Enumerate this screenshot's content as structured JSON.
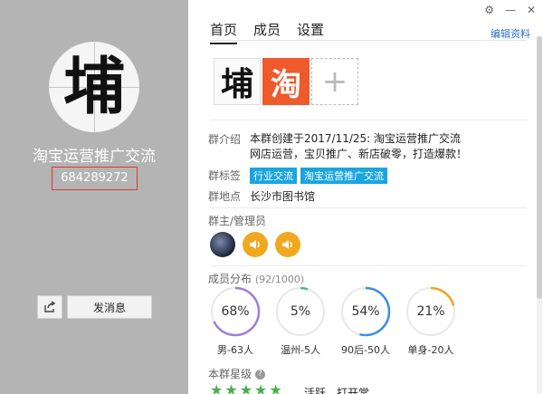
{
  "profile": {
    "avatar_char": "埔",
    "group_name": "淘宝运营推广交流",
    "group_id": "684289272",
    "message_button": "发消息"
  },
  "tabs": [
    {
      "label": "首页",
      "active": true
    },
    {
      "label": "成员",
      "active": false
    },
    {
      "label": "设置",
      "active": false
    }
  ],
  "edit_label": "编辑资料",
  "photos": {
    "photo1_char": "埔",
    "photo2_char": "淘",
    "add_symbol": "+"
  },
  "info": {
    "intro_label": "群介绍",
    "intro_line1": "本群创建于2017/11/25: 淘宝运营推广交流",
    "intro_line2": "网店运营，宝贝推广、新店破零，打造爆款！",
    "tags_label": "群标签",
    "tags": [
      "行业交流",
      "淘宝运营推广交流"
    ],
    "location_label": "群地点",
    "location": "长沙市图书馆"
  },
  "admins_title": "群主/管理员",
  "distribution": {
    "title": "成员分布",
    "count": "(92/1000)",
    "items": [
      {
        "pct": "68%",
        "value": 0.68,
        "label": "男-63人",
        "color": "#9b7fd4"
      },
      {
        "pct": "5%",
        "value": 0.05,
        "label": "温州-5人",
        "color": "#39c08c"
      },
      {
        "pct": "54%",
        "value": 0.54,
        "label": "90后-50人",
        "color": "#3a8ee6"
      },
      {
        "pct": "21%",
        "value": 0.21,
        "label": "单身-20人",
        "color": "#f2a024"
      }
    ]
  },
  "rating": {
    "title": "本群星级",
    "stars": 5,
    "text": "活跃，打开常"
  },
  "colors": {
    "left_bg": "#b4b4b4",
    "tag_bg": "#1aa5e0",
    "id_border": "#e0392b",
    "link": "#2a6fc4"
  }
}
